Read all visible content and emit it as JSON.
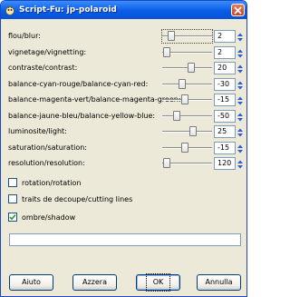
{
  "window": {
    "title": "Script-Fu: jp-polaroid"
  },
  "params": [
    {
      "label": "flou/blur:",
      "value": "2",
      "slider_fraction": 0.12,
      "focused": true
    },
    {
      "label": "vignetage/vignetting:",
      "value": "2",
      "slider_fraction": 0.02
    },
    {
      "label": "contraste/contrast:",
      "value": "20",
      "slider_fraction": 0.6
    },
    {
      "label": "balance-cyan-rouge/balance-cyan-red:",
      "value": "-30",
      "slider_fraction": 0.38
    },
    {
      "label": "balance-magenta-vert/balance-magenta-green:",
      "value": "-15",
      "slider_fraction": 0.45
    },
    {
      "label": "balance-jaune-bleu/balance-yellow-blue:",
      "value": "-50",
      "slider_fraction": 0.25
    },
    {
      "label": "luminosite/light:",
      "value": "25",
      "slider_fraction": 0.63
    },
    {
      "label": "saturation/saturation:",
      "value": "-15",
      "slider_fraction": 0.45
    },
    {
      "label": "resolution/resolution:",
      "value": "120",
      "slider_fraction": 0.03
    }
  ],
  "checkboxes": [
    {
      "label": "rotation/rotation",
      "checked": false
    },
    {
      "label": "traits de decoupe/cutting lines",
      "checked": false
    },
    {
      "label": "ombre/shadow",
      "checked": true
    }
  ],
  "text_input": {
    "value": ""
  },
  "buttons": {
    "help": "Aiuto",
    "reset": "Azzera",
    "ok": "OK",
    "cancel": "Annulla"
  },
  "colors": {
    "titlebar": "#0a5ce6",
    "dialog_bg": "#ece9d8",
    "check": "#21a121"
  }
}
